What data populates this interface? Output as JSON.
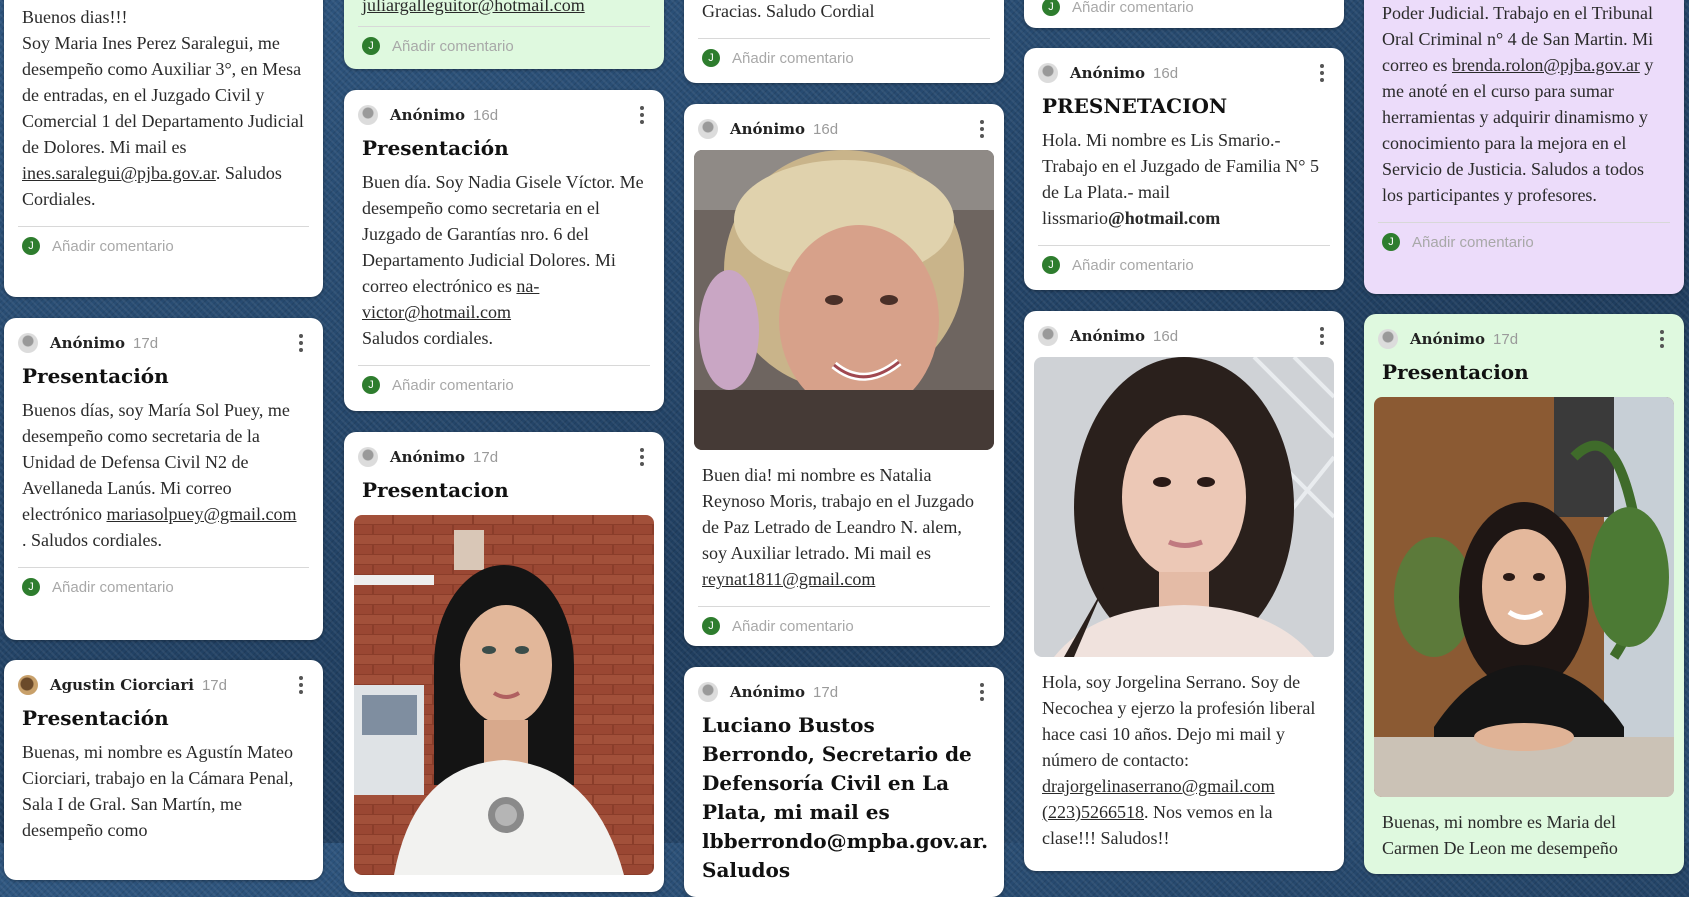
{
  "common": {
    "comment_placeholder": "Añadir comentario",
    "comment_avatar_letter": "J"
  },
  "col1": {
    "post1": {
      "body": [
        "Buenos dias!!!",
        "Soy Maria Ines Perez Saralegui, me desempeño como Auxiliar 3°, en Mesa de entradas, en el Juzgado Civil y Comercial 1 del Departamento Judicial de Dolores. Mi mail es ",
        "ines.saralegui@pjba.gov.ar",
        ". Saludos Cordiales."
      ]
    },
    "post2": {
      "author": "Anónimo",
      "time": "17d",
      "title": "Presentación",
      "body": [
        "Buenos días, soy María Sol Puey, me desempeño como secretaria de la Unidad de Defensa Civil N2 de Avellaneda Lanús. Mi correo electrónico ",
        "mariasolpuey@gmail.com",
        " . Saludos cordiales."
      ]
    },
    "post3": {
      "author": "Agustin Ciorciari",
      "time": "17d",
      "title": "Presentación",
      "body": "Buenas, mi nombre es Agustín Mateo Ciorciari, trabajo en la Cámara Penal, Sala I de Gral. San Martín, me desempeño como"
    }
  },
  "col2": {
    "post1": {
      "body_partial": "juliargalleguitor@hotmail.com"
    },
    "post2": {
      "author": "Anónimo",
      "time": "16d",
      "title": "Presentación",
      "body": [
        "Buen día. Soy Nadia Gisele Víctor. Me desempeño como secretaria en el Juzgado de Garantías nro. 6 del Departamento Judicial Dolores. Mi correo electrónico es ",
        "na-victor@hotmail.com",
        "Saludos cordiales."
      ]
    },
    "post3": {
      "author": "Anónimo",
      "time": "17d",
      "title": "Presentacion"
    }
  },
  "col3": {
    "post1": {
      "body": "Gracias. Saludo Cordial"
    },
    "post2": {
      "author": "Anónimo",
      "time": "16d",
      "body": [
        "Buen dia! mi nombre es Natalia Reynoso Moris, trabajo en el Juzgado de Paz Letrado de Leandro N. alem, soy Auxiliar letrado. Mi mail es ",
        "reynat1811@gmail.com"
      ]
    },
    "post3": {
      "author": "Anónimo",
      "time": "17d",
      "title": "Luciano Bustos Berrondo, Secretario de Defensoría Civil en La Plata, mi mail es lbberrondo@mpba.gov.ar. Saludos"
    }
  },
  "col4": {
    "post1": {},
    "post2": {
      "author": "Anónimo",
      "time": "16d",
      "title": "PRESNETACION",
      "body": [
        "Hola. Mi nombre es Lis Smario.- Trabajo en el Juzgado de Familia N° 5 de La Plata.- mail lissmario",
        "@hotmail.com"
      ]
    },
    "post3": {
      "author": "Anónimo",
      "time": "16d",
      "body": [
        "Hola, soy Jorgelina Serrano. Soy de Necochea y ejerzo la profesión liberal hace casi 10 años. Dejo mi mail y número de contacto: ",
        "drajorgelinaserrano@gmail.com",
        "(223)5266518",
        ". Nos vemos en la clase!!! Saludos!!"
      ]
    }
  },
  "col5": {
    "post1": {
      "body": [
        "Poder Judicial. Trabajo en el Tribunal Oral Criminal n° 4 de San Martin. Mi correo es ",
        "brenda.rolon@pjba.gov.ar",
        " y me anoté en el curso para sumar herramientas y adquirir dinamismo y conocimiento para la mejora en el Servicio de Justicia. Saludos a todos los participantes y profesores."
      ]
    },
    "post2": {
      "author": "Anónimo",
      "time": "17d",
      "title": "Presentacion",
      "body": "Buenas, mi nombre es Maria del Carmen De Leon me desempeño"
    }
  }
}
